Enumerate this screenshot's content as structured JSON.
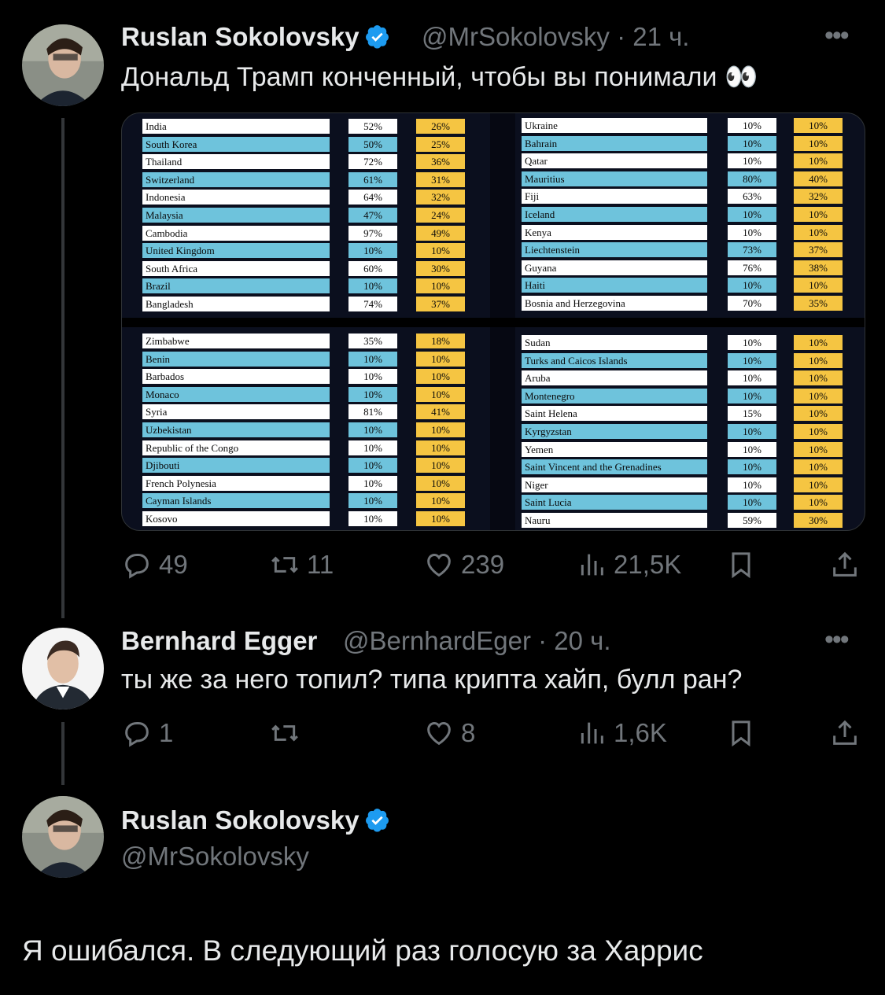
{
  "tweet1": {
    "author": "Ruslan Sokolovsky",
    "handle": "@MrSokolovsky",
    "time": "· 21 ч.",
    "text": "Дональд Трамп конченный, чтобы вы понимали 👀",
    "stats": {
      "replies": "49",
      "reposts": "11",
      "likes": "239",
      "views": "21,5K"
    },
    "table_top_left": [
      {
        "country": "India",
        "a": "52%",
        "b": "26%"
      },
      {
        "country": "South Korea",
        "a": "50%",
        "b": "25%"
      },
      {
        "country": "Thailand",
        "a": "72%",
        "b": "36%"
      },
      {
        "country": "Switzerland",
        "a": "61%",
        "b": "31%"
      },
      {
        "country": "Indonesia",
        "a": "64%",
        "b": "32%"
      },
      {
        "country": "Malaysia",
        "a": "47%",
        "b": "24%"
      },
      {
        "country": "Cambodia",
        "a": "97%",
        "b": "49%"
      },
      {
        "country": "United Kingdom",
        "a": "10%",
        "b": "10%"
      },
      {
        "country": "South Africa",
        "a": "60%",
        "b": "30%"
      },
      {
        "country": "Brazil",
        "a": "10%",
        "b": "10%"
      },
      {
        "country": "Bangladesh",
        "a": "74%",
        "b": "37%"
      }
    ],
    "table_bottom_left": [
      {
        "country": "Zimbabwe",
        "a": "35%",
        "b": "18%"
      },
      {
        "country": "Benin",
        "a": "10%",
        "b": "10%"
      },
      {
        "country": "Barbados",
        "a": "10%",
        "b": "10%"
      },
      {
        "country": "Monaco",
        "a": "10%",
        "b": "10%"
      },
      {
        "country": "Syria",
        "a": "81%",
        "b": "41%"
      },
      {
        "country": "Uzbekistan",
        "a": "10%",
        "b": "10%"
      },
      {
        "country": "Republic of the Congo",
        "a": "10%",
        "b": "10%"
      },
      {
        "country": "Djibouti",
        "a": "10%",
        "b": "10%"
      },
      {
        "country": "French Polynesia",
        "a": "10%",
        "b": "10%"
      },
      {
        "country": "Cayman Islands",
        "a": "10%",
        "b": "10%"
      },
      {
        "country": "Kosovo",
        "a": "10%",
        "b": "10%"
      }
    ],
    "table_top_right": [
      {
        "country": "Ukraine",
        "a": "10%",
        "b": "10%"
      },
      {
        "country": "Bahrain",
        "a": "10%",
        "b": "10%"
      },
      {
        "country": "Qatar",
        "a": "10%",
        "b": "10%"
      },
      {
        "country": "Mauritius",
        "a": "80%",
        "b": "40%"
      },
      {
        "country": "Fiji",
        "a": "63%",
        "b": "32%"
      },
      {
        "country": "Iceland",
        "a": "10%",
        "b": "10%"
      },
      {
        "country": "Kenya",
        "a": "10%",
        "b": "10%"
      },
      {
        "country": "Liechtenstein",
        "a": "73%",
        "b": "37%"
      },
      {
        "country": "Guyana",
        "a": "76%",
        "b": "38%"
      },
      {
        "country": "Haiti",
        "a": "10%",
        "b": "10%"
      },
      {
        "country": "Bosnia and Herzegovina",
        "a": "70%",
        "b": "35%"
      }
    ],
    "table_bottom_right": [
      {
        "country": "Sudan",
        "a": "10%",
        "b": "10%"
      },
      {
        "country": "Turks and Caicos Islands",
        "a": "10%",
        "b": "10%"
      },
      {
        "country": "Aruba",
        "a": "10%",
        "b": "10%"
      },
      {
        "country": "Montenegro",
        "a": "10%",
        "b": "10%"
      },
      {
        "country": "Saint Helena",
        "a": "15%",
        "b": "10%"
      },
      {
        "country": "Kyrgyzstan",
        "a": "10%",
        "b": "10%"
      },
      {
        "country": "Yemen",
        "a": "10%",
        "b": "10%"
      },
      {
        "country": "Saint Vincent and the Grenadines",
        "a": "10%",
        "b": "10%"
      },
      {
        "country": "Niger",
        "a": "10%",
        "b": "10%"
      },
      {
        "country": "Saint Lucia",
        "a": "10%",
        "b": "10%"
      },
      {
        "country": "Nauru",
        "a": "59%",
        "b": "30%"
      }
    ]
  },
  "tweet2": {
    "author": "Bernhard Egger",
    "handle": "@BernhardEger",
    "time": "· 20 ч.",
    "text": "ты же за него топил? типа крипта хайп, булл ран?",
    "stats": {
      "replies": "1",
      "reposts": "",
      "likes": "8",
      "views": "1,6K"
    }
  },
  "tweet3": {
    "author": "Ruslan Sokolovsky",
    "handle": "@MrSokolovsky",
    "text": "Я ошибался. В следующий раз голосую за Харрис"
  },
  "colors": {
    "background": "#000000",
    "muted": "#71767b",
    "verified": "#1d9bf0",
    "row_blue": "#6ec3dc",
    "row_white": "#ffffff",
    "tariff_yellow": "#f5c542"
  },
  "icons": [
    "reply-icon",
    "repost-icon",
    "like-icon",
    "views-icon",
    "bookmark-icon",
    "share-icon",
    "verified-icon",
    "more-icon"
  ]
}
